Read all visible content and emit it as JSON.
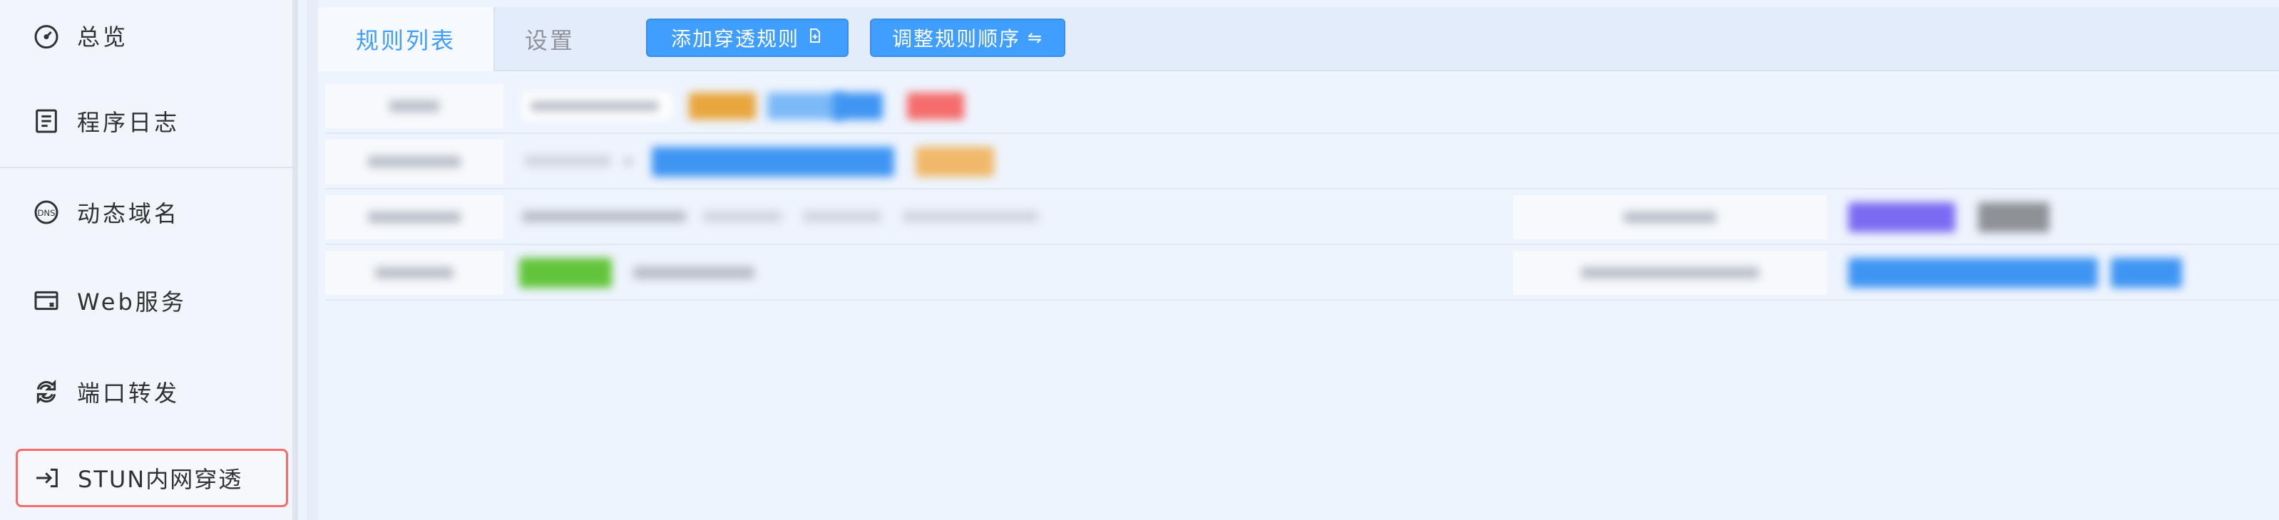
{
  "sidebar": {
    "items": [
      {
        "label": "总览",
        "icon": "dashboard-icon"
      },
      {
        "label": "程序日志",
        "icon": "log-icon"
      },
      {
        "label": "动态域名",
        "icon": "dns-icon"
      },
      {
        "label": "Web服务",
        "icon": "web-service-icon"
      },
      {
        "label": "端口转发",
        "icon": "port-forward-icon"
      },
      {
        "label": "STUN内网穿透",
        "icon": "stun-icon"
      }
    ]
  },
  "tabs": [
    {
      "label": "规则列表",
      "active": true
    },
    {
      "label": "设置",
      "active": false
    }
  ],
  "toolbar": {
    "add_label": "添加穿透规则",
    "add_icon": "add-document-icon",
    "order_label": "调整规则顺序",
    "order_icon": "swap-arrows-icon"
  },
  "colors": {
    "accent": "#409eff",
    "active_outline": "#f56c6c",
    "background": "#eef4fd"
  }
}
